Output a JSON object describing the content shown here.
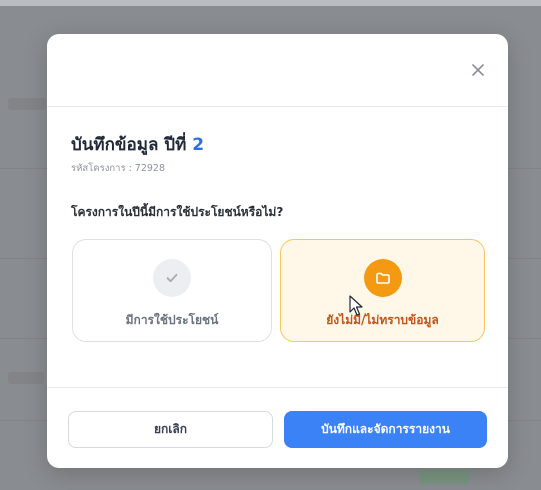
{
  "modal": {
    "title": "บันทึกข้อมูล ปีที่",
    "year": "2",
    "project_code": "รหัสโครงการ : 72928",
    "question": "โครงการในปีนี้มีการใช้ประโยชน์หรือไม่?",
    "options": [
      {
        "label": "มีการใช้ประโยชน์",
        "icon": "check-icon",
        "selected": false
      },
      {
        "label": "ยังไม่มี/ไม่ทราบข้อมูล",
        "icon": "folder-icon",
        "selected": true
      }
    ],
    "cancel_label": "ยกเลิก",
    "save_label": "บันทึกและจัดการรายงาน",
    "close_icon": "close-icon"
  },
  "colors": {
    "accent": "#3b82f6",
    "year_highlight": "#2d6fe0",
    "selected_border": "#f5c75e",
    "selected_bg": "#fff8e9",
    "selected_icon_bg": "#f39a12",
    "selected_text": "#c0551a"
  }
}
